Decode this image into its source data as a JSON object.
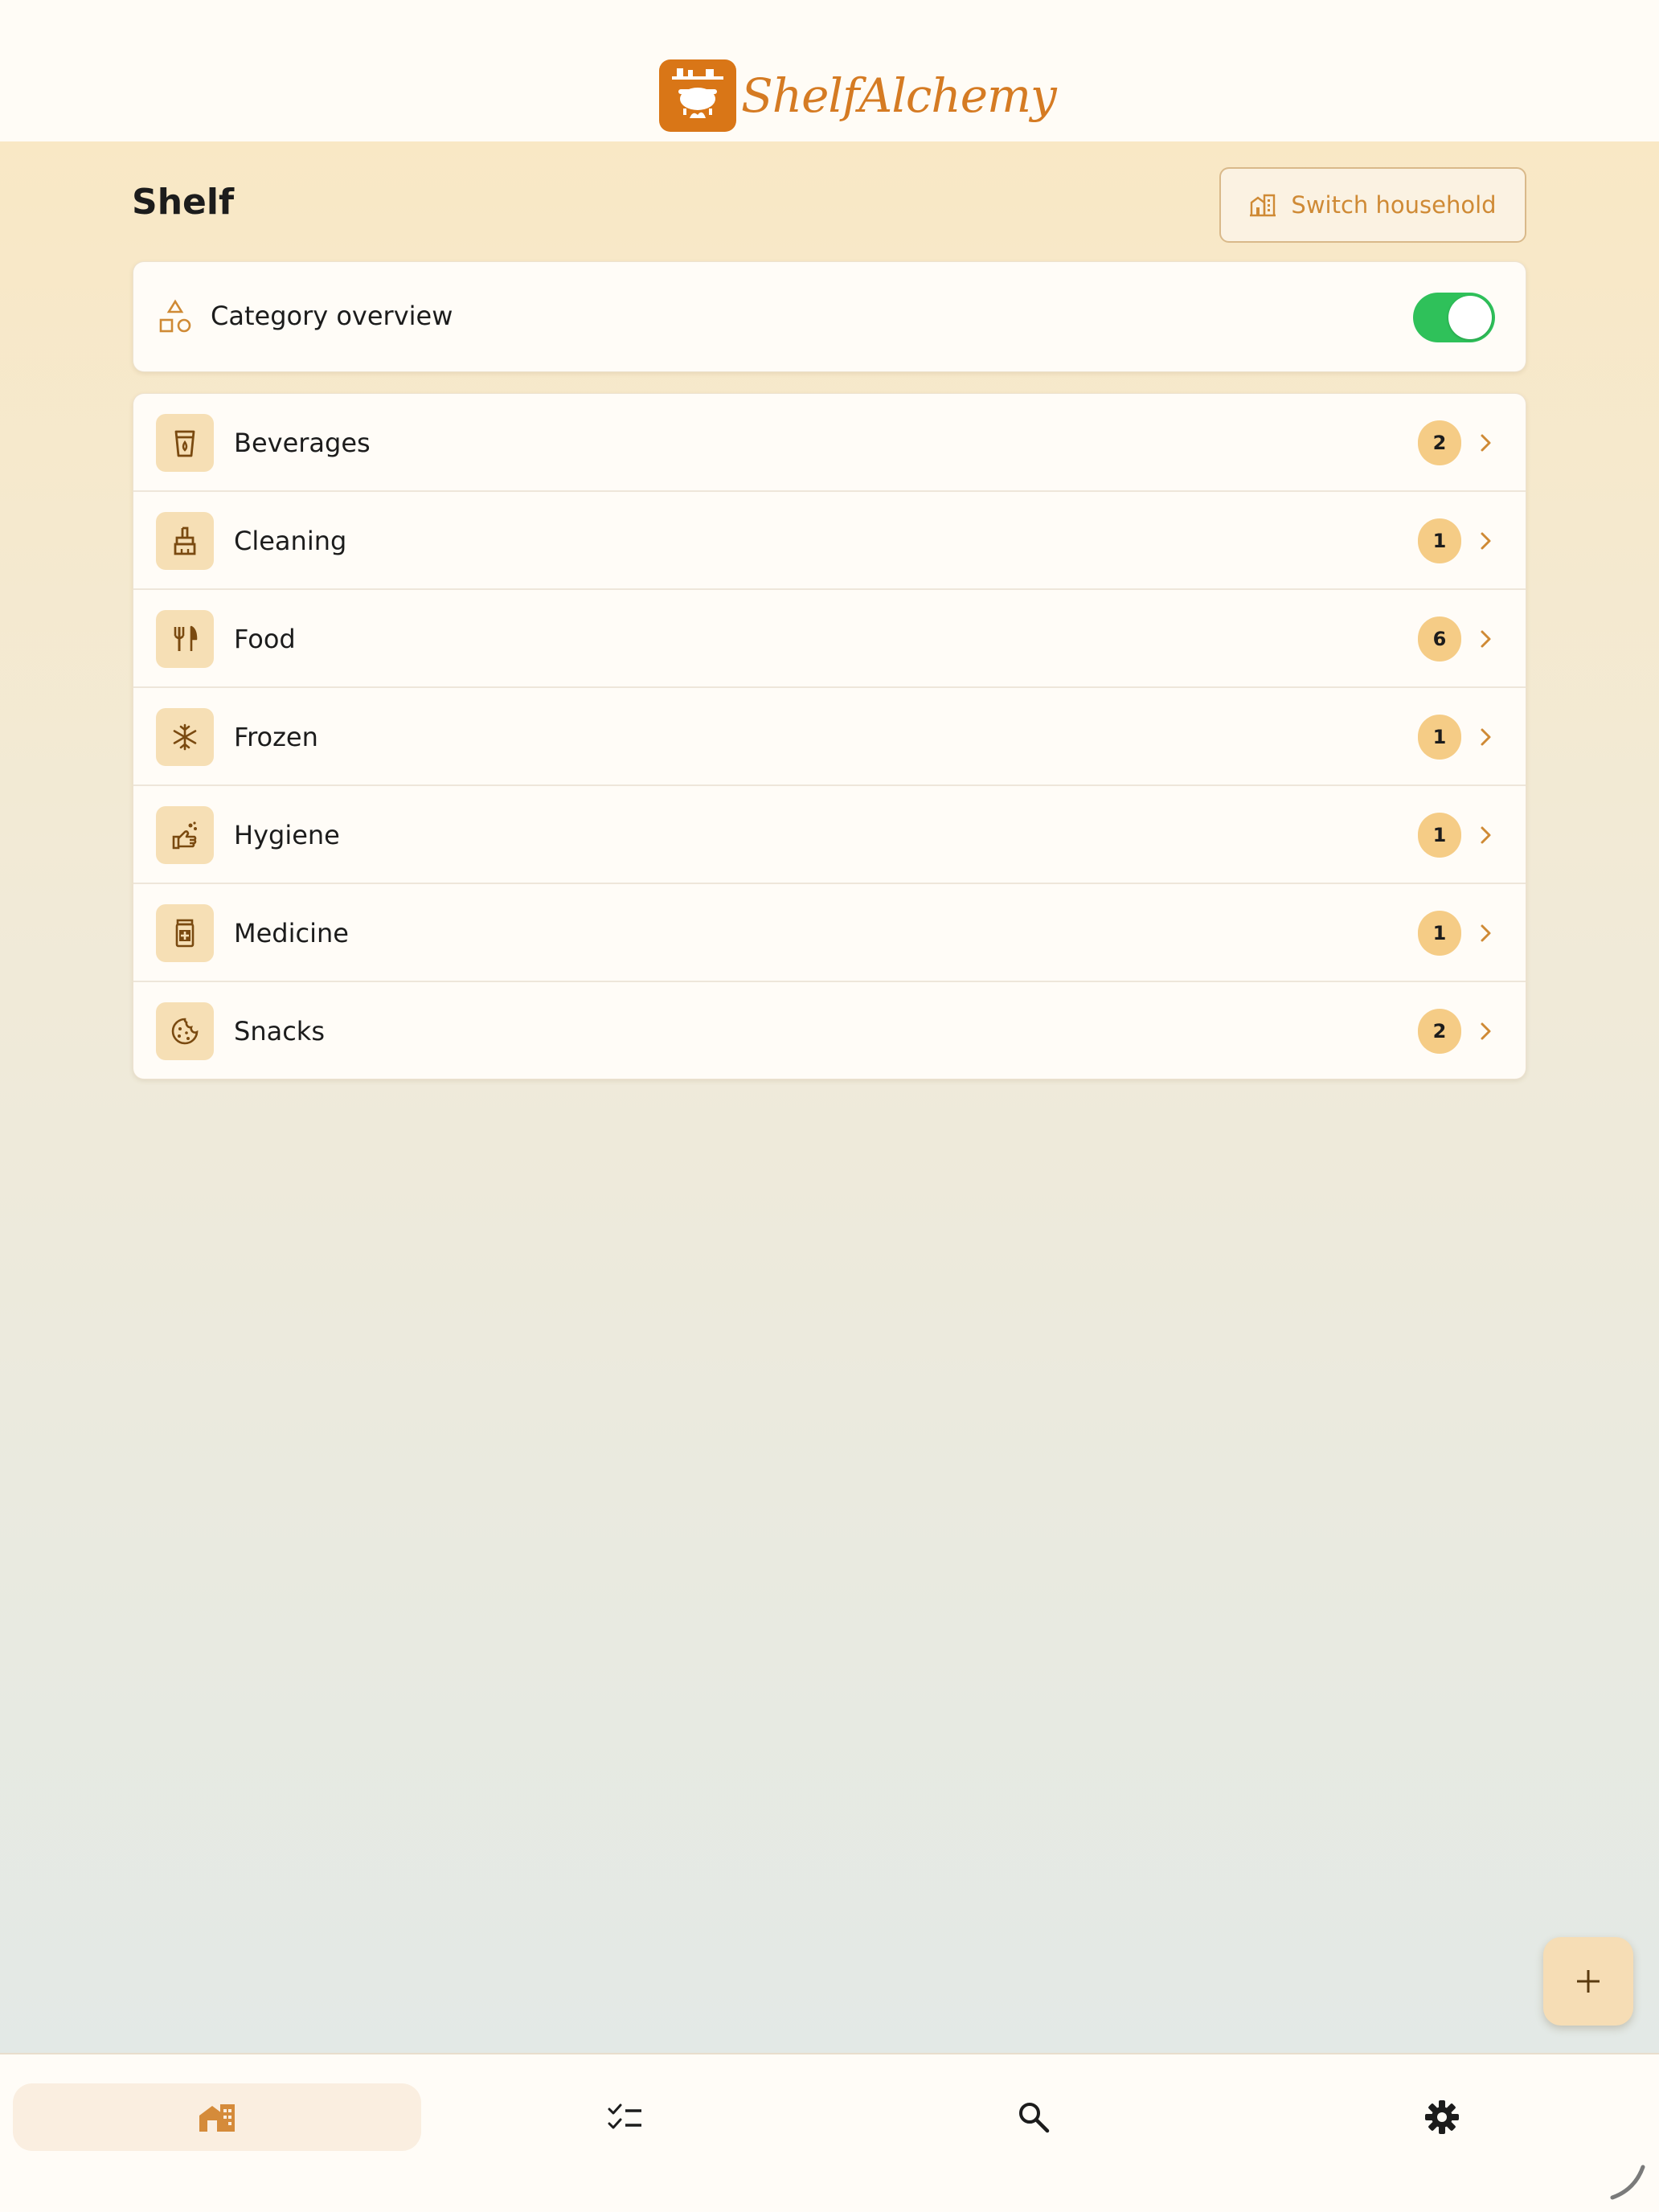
{
  "header": {
    "app_name": "ShelfAlchemy"
  },
  "page": {
    "title": "Shelf",
    "switch_household_label": "Switch household"
  },
  "overview": {
    "label": "Category overview",
    "enabled": true
  },
  "categories": [
    {
      "label": "Beverages",
      "count": "2",
      "icon": "beverage-cup-icon"
    },
    {
      "label": "Cleaning",
      "count": "1",
      "icon": "broom-icon"
    },
    {
      "label": "Food",
      "count": "6",
      "icon": "fork-knife-icon"
    },
    {
      "label": "Frozen",
      "count": "1",
      "icon": "snowflake-icon"
    },
    {
      "label": "Hygiene",
      "count": "1",
      "icon": "hand-soap-icon"
    },
    {
      "label": "Medicine",
      "count": "1",
      "icon": "medicine-bottle-icon"
    },
    {
      "label": "Snacks",
      "count": "2",
      "icon": "cookie-icon"
    }
  ],
  "colors": {
    "accent": "#d57b23",
    "badge": "#f5cc86",
    "toggle_on": "#2fc15a",
    "icon_bg": "#f6dfb5"
  },
  "nav": {
    "items": [
      {
        "name": "home",
        "icon": "home-icon",
        "active": true
      },
      {
        "name": "list",
        "icon": "checklist-icon",
        "active": false
      },
      {
        "name": "search",
        "icon": "search-icon",
        "active": false
      },
      {
        "name": "settings",
        "icon": "gear-icon",
        "active": false
      }
    ]
  }
}
